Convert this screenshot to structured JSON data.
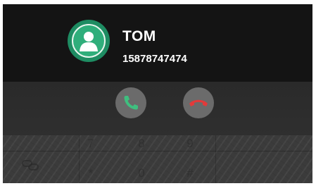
{
  "caller": {
    "name": "TOM",
    "number": "15878747474"
  },
  "icons": {
    "avatar": "person-icon",
    "answer": "phone-answer-icon",
    "hangup": "phone-hangup-icon",
    "link": "link-icon"
  },
  "colors": {
    "background": "#121212",
    "avatar_green": "#2fae7b",
    "answer_green": "#3fbf7f",
    "hangup_red": "#e23a3a",
    "button_gray": "#6b6b6b"
  },
  "keypad": {
    "row1": [
      "7",
      "8",
      "9"
    ],
    "row2": [
      "*",
      "0",
      "#"
    ]
  }
}
